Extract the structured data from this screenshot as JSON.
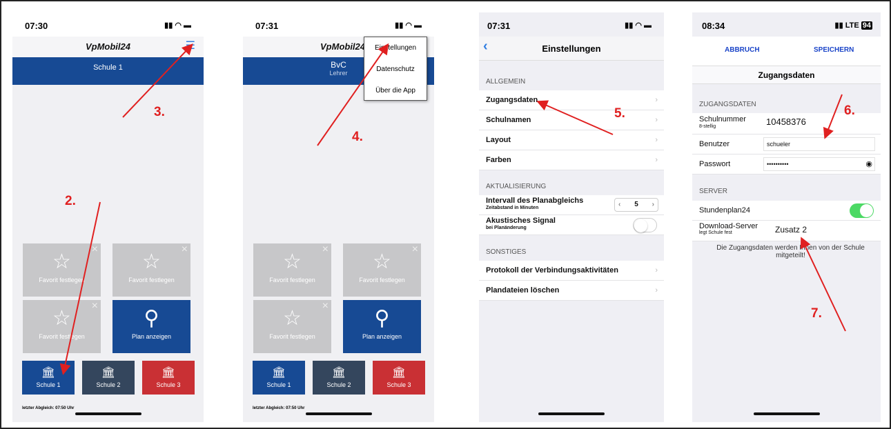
{
  "s1": {
    "time": "07:30",
    "title": "VpMobil24",
    "school_header": "Schule 1",
    "fav_label": "Favorit festlegen",
    "plan_label": "Plan anzeigen",
    "schools": [
      "Schule 1",
      "Schule 2",
      "Schule 3"
    ],
    "footer": "letzter Abgleich: 07:50 Uhr",
    "colors": {
      "school1": "#174a94",
      "school2": "#34465d",
      "school3": "#c93034"
    }
  },
  "s2": {
    "time": "07:31",
    "title": "VpMobil24",
    "class_name": "BvC",
    "role": "Lehrer",
    "menu": [
      "Einstellungen",
      "Datenschutz",
      "Über die App"
    ],
    "fav_label": "Favorit festlegen",
    "plan_label": "Plan anzeigen",
    "schools": [
      "Schule 1",
      "Schule 2",
      "Schule 3"
    ],
    "footer": "letzter Abgleich: 07:50 Uhr"
  },
  "s3": {
    "time": "07:31",
    "title": "Einstellungen",
    "sec_general": "ALLGEMEIN",
    "general": [
      "Zugangsdaten",
      "Schulnamen",
      "Layout",
      "Farben"
    ],
    "sec_update": "AKTUALISIERUNG",
    "interval_label": "Intervall des Planabgleichs",
    "interval_sub": "Zeitabstand in Minuten",
    "interval_value": "5",
    "signal_label": "Akustisches Signal",
    "signal_sub": "bei Planänderung",
    "sec_other": "SONSTIGES",
    "other": [
      "Protokoll der Verbindungsaktivitäten",
      "Plandateien löschen"
    ]
  },
  "s4": {
    "time": "08:34",
    "network": "LTE",
    "battery": "94",
    "cancel": "ABBRUCH",
    "save": "SPEICHERN",
    "title": "Zugangsdaten",
    "sec_access": "ZUGANGSDATEN",
    "school_no_label": "Schulnummer",
    "school_no_sub": "8-stellig",
    "school_no_value": "10458376",
    "user_label": "Benutzer",
    "user_value": "schueler",
    "pw_label": "Passwort",
    "pw_value": "••••••••••",
    "sec_server": "SERVER",
    "sp24_label": "Stundenplan24",
    "dl_label": "Download-Server",
    "dl_sub": "legt Schule fest",
    "dl_value": "Zusatz 2",
    "note": "Die Zugangsdaten werden Ihnen von der Schule mitgeteilt!"
  },
  "steps": [
    "2.",
    "3.",
    "4.",
    "5.",
    "6.",
    "7."
  ],
  "arrow_color": "#e02020"
}
